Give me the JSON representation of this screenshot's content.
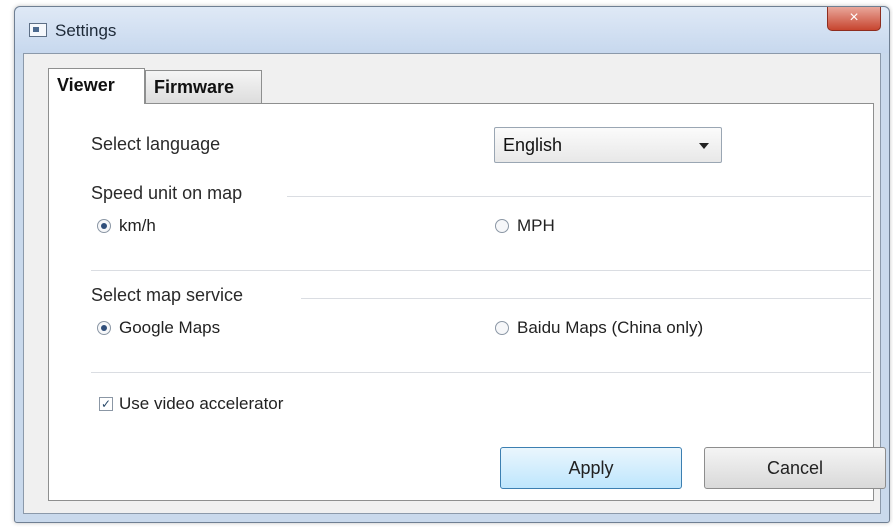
{
  "window": {
    "title": "Settings",
    "close_label": "×"
  },
  "tabs": [
    {
      "label": "Viewer",
      "active": true
    },
    {
      "label": "Firmware",
      "active": false
    }
  ],
  "viewer": {
    "language_label": "Select language",
    "language_value": "English",
    "speed_group_label": "Speed unit on map",
    "speed_options": [
      {
        "label": "km/h",
        "checked": true
      },
      {
        "label": "MPH",
        "checked": false
      }
    ],
    "map_group_label": "Select map service",
    "map_options": [
      {
        "label": "Google Maps",
        "checked": true
      },
      {
        "label": "Baidu Maps (China only)",
        "checked": false
      }
    ],
    "accelerator_label": "Use video accelerator",
    "accelerator_checked": true
  },
  "buttons": {
    "apply": "Apply",
    "cancel": "Cancel"
  },
  "colors": {
    "title_bar": "#c7d8ee",
    "close_button": "#c7452f",
    "apply_button": "#bee6fd"
  }
}
